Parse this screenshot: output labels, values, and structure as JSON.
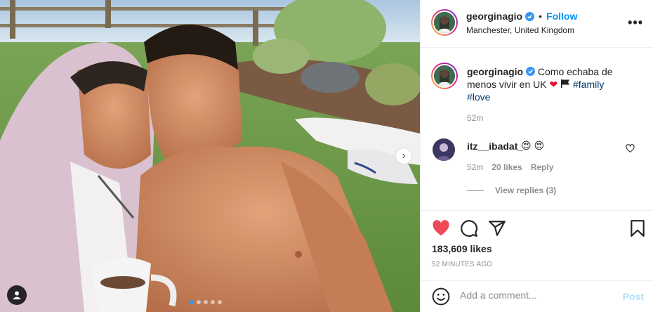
{
  "post": {
    "media": {
      "current_slide": 1,
      "slide_count": 5
    },
    "header": {
      "username": "georginagio",
      "separator": "•",
      "follow_label": "Follow",
      "location": "Manchester, United Kingdom",
      "more_label": "•••"
    },
    "caption": {
      "username": "georginagio",
      "text": "Como echaba de menos vivir en UK",
      "hashtags": [
        "#family",
        "#love"
      ],
      "time": "52m"
    },
    "comment": {
      "username": "itz__ibadat_",
      "text": "😍 😍",
      "time": "52m",
      "likes": "20 likes",
      "reply_label": "Reply",
      "view_replies": "View replies (3)"
    },
    "likes_count": "183,609 likes",
    "time_ago": "52 MINUTES AGO",
    "add_comment": {
      "placeholder": "Add a comment...",
      "post_label": "Post"
    },
    "icons": [
      "heart-icon",
      "comment-icon",
      "share-icon",
      "bookmark-icon",
      "emoji-icon",
      "verified-icon",
      "tag-user-icon",
      "next-arrow-icon"
    ],
    "colors": {
      "link": "#0095f6",
      "like_red": "#ed4956",
      "hashtag": "#00376b",
      "muted": "#8e8e8e"
    }
  }
}
